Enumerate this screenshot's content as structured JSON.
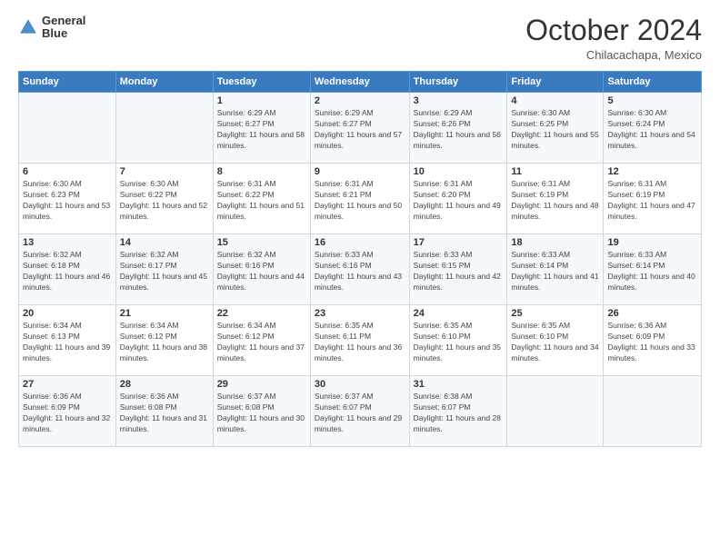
{
  "logo": {
    "line1": "General",
    "line2": "Blue"
  },
  "title": "October 2024",
  "location": "Chilacachapa, Mexico",
  "days_header": [
    "Sunday",
    "Monday",
    "Tuesday",
    "Wednesday",
    "Thursday",
    "Friday",
    "Saturday"
  ],
  "weeks": [
    [
      {
        "day": "",
        "info": ""
      },
      {
        "day": "",
        "info": ""
      },
      {
        "day": "1",
        "info": "Sunrise: 6:29 AM\nSunset: 6:27 PM\nDaylight: 11 hours and 58 minutes."
      },
      {
        "day": "2",
        "info": "Sunrise: 6:29 AM\nSunset: 6:27 PM\nDaylight: 11 hours and 57 minutes."
      },
      {
        "day": "3",
        "info": "Sunrise: 6:29 AM\nSunset: 6:26 PM\nDaylight: 11 hours and 56 minutes."
      },
      {
        "day": "4",
        "info": "Sunrise: 6:30 AM\nSunset: 6:25 PM\nDaylight: 11 hours and 55 minutes."
      },
      {
        "day": "5",
        "info": "Sunrise: 6:30 AM\nSunset: 6:24 PM\nDaylight: 11 hours and 54 minutes."
      }
    ],
    [
      {
        "day": "6",
        "info": "Sunrise: 6:30 AM\nSunset: 6:23 PM\nDaylight: 11 hours and 53 minutes."
      },
      {
        "day": "7",
        "info": "Sunrise: 6:30 AM\nSunset: 6:22 PM\nDaylight: 11 hours and 52 minutes."
      },
      {
        "day": "8",
        "info": "Sunrise: 6:31 AM\nSunset: 6:22 PM\nDaylight: 11 hours and 51 minutes."
      },
      {
        "day": "9",
        "info": "Sunrise: 6:31 AM\nSunset: 6:21 PM\nDaylight: 11 hours and 50 minutes."
      },
      {
        "day": "10",
        "info": "Sunrise: 6:31 AM\nSunset: 6:20 PM\nDaylight: 11 hours and 49 minutes."
      },
      {
        "day": "11",
        "info": "Sunrise: 6:31 AM\nSunset: 6:19 PM\nDaylight: 11 hours and 48 minutes."
      },
      {
        "day": "12",
        "info": "Sunrise: 6:31 AM\nSunset: 6:19 PM\nDaylight: 11 hours and 47 minutes."
      }
    ],
    [
      {
        "day": "13",
        "info": "Sunrise: 6:32 AM\nSunset: 6:18 PM\nDaylight: 11 hours and 46 minutes."
      },
      {
        "day": "14",
        "info": "Sunrise: 6:32 AM\nSunset: 6:17 PM\nDaylight: 11 hours and 45 minutes."
      },
      {
        "day": "15",
        "info": "Sunrise: 6:32 AM\nSunset: 6:16 PM\nDaylight: 11 hours and 44 minutes."
      },
      {
        "day": "16",
        "info": "Sunrise: 6:33 AM\nSunset: 6:16 PM\nDaylight: 11 hours and 43 minutes."
      },
      {
        "day": "17",
        "info": "Sunrise: 6:33 AM\nSunset: 6:15 PM\nDaylight: 11 hours and 42 minutes."
      },
      {
        "day": "18",
        "info": "Sunrise: 6:33 AM\nSunset: 6:14 PM\nDaylight: 11 hours and 41 minutes."
      },
      {
        "day": "19",
        "info": "Sunrise: 6:33 AM\nSunset: 6:14 PM\nDaylight: 11 hours and 40 minutes."
      }
    ],
    [
      {
        "day": "20",
        "info": "Sunrise: 6:34 AM\nSunset: 6:13 PM\nDaylight: 11 hours and 39 minutes."
      },
      {
        "day": "21",
        "info": "Sunrise: 6:34 AM\nSunset: 6:12 PM\nDaylight: 11 hours and 38 minutes."
      },
      {
        "day": "22",
        "info": "Sunrise: 6:34 AM\nSunset: 6:12 PM\nDaylight: 11 hours and 37 minutes."
      },
      {
        "day": "23",
        "info": "Sunrise: 6:35 AM\nSunset: 6:11 PM\nDaylight: 11 hours and 36 minutes."
      },
      {
        "day": "24",
        "info": "Sunrise: 6:35 AM\nSunset: 6:10 PM\nDaylight: 11 hours and 35 minutes."
      },
      {
        "day": "25",
        "info": "Sunrise: 6:35 AM\nSunset: 6:10 PM\nDaylight: 11 hours and 34 minutes."
      },
      {
        "day": "26",
        "info": "Sunrise: 6:36 AM\nSunset: 6:09 PM\nDaylight: 11 hours and 33 minutes."
      }
    ],
    [
      {
        "day": "27",
        "info": "Sunrise: 6:36 AM\nSunset: 6:09 PM\nDaylight: 11 hours and 32 minutes."
      },
      {
        "day": "28",
        "info": "Sunrise: 6:36 AM\nSunset: 6:08 PM\nDaylight: 11 hours and 31 minutes."
      },
      {
        "day": "29",
        "info": "Sunrise: 6:37 AM\nSunset: 6:08 PM\nDaylight: 11 hours and 30 minutes."
      },
      {
        "day": "30",
        "info": "Sunrise: 6:37 AM\nSunset: 6:07 PM\nDaylight: 11 hours and 29 minutes."
      },
      {
        "day": "31",
        "info": "Sunrise: 6:38 AM\nSunset: 6:07 PM\nDaylight: 11 hours and 28 minutes."
      },
      {
        "day": "",
        "info": ""
      },
      {
        "day": "",
        "info": ""
      }
    ]
  ]
}
